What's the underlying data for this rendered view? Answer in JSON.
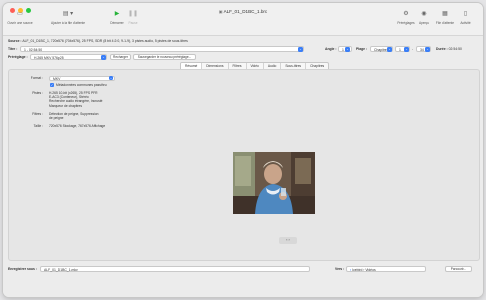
{
  "window": {
    "title": "ALF_01_D1BC_1.brc"
  },
  "toolbar": {
    "left": [
      {
        "label": "Ouvrir une source",
        "icon": "film-icon"
      },
      {
        "label": "Ajouter à la file d'attente",
        "icon": "queue-add-icon"
      },
      {
        "label": "Démarrer",
        "icon": "play-icon"
      },
      {
        "label": "Pause",
        "icon": "pause-icon"
      }
    ],
    "right": [
      {
        "label": "Préréglages",
        "icon": "presets-icon"
      },
      {
        "label": "Aperçu",
        "icon": "eye-icon"
      },
      {
        "label": "File d'attente",
        "icon": "queue-icon"
      },
      {
        "label": "Activité",
        "icon": "activity-icon"
      }
    ]
  },
  "source": {
    "label": "Source :",
    "value": "ALF_01_D1BC_1, 720x576 (704x576), 25 FPS, SDR (8 bit 4:2:0, 9-1-9), 3 pistes audio, 5 pistes de sous-titres"
  },
  "title_row": {
    "label": "Titre :",
    "value": "1 - 02:54:50",
    "angle_label": "Angle :",
    "angle_value": "1",
    "range_label": "Plage :",
    "range_mode": "Chapitres",
    "range_start": "1",
    "range_to": "-",
    "range_end": "34",
    "duration_label": "Durée :",
    "duration_value": "02:54:50"
  },
  "preset_row": {
    "label": "Préréglage :",
    "value": "H.265 MKV 576p25",
    "reload_label": "Recharger",
    "save_label": "Sauvegarder le nouveau préréglage..."
  },
  "tabs": [
    {
      "label": "Résumé",
      "active": true
    },
    {
      "label": "Dimensions",
      "active": false
    },
    {
      "label": "Filtres",
      "active": false
    },
    {
      "label": "Vidéo",
      "active": false
    },
    {
      "label": "Audio",
      "active": false
    },
    {
      "label": "Sous-titres",
      "active": false
    },
    {
      "label": "Chapitres",
      "active": false
    }
  ],
  "summary": {
    "format_label": "Format :",
    "format_value": "MKV",
    "passthru_label": "Métadonnées communes passthru",
    "tracks_label": "Pistes :",
    "tracks_value": "H.265 10-bit (x265), 25 FPS PFR\nE-AC3 (Conteneur), Stéréo\nRecherche audio étrangère, Incrusté\nMarqueur de chapitres",
    "filters_label": "Filtres :",
    "filters_value": "Détection de peigne, Suppression\nde peigne",
    "size_label": "Taille :",
    "size_value": "720x576 Stockage, 767x576 Affichage"
  },
  "preview": {
    "pager": "‹  ›"
  },
  "bottom": {
    "save_label": "Enregistrer sous :",
    "save_value": "ALF_01_D1BC_1.mkv",
    "to_label": "Vers :",
    "to_value": "Icebird › Vidéos",
    "browse_label": "Parcourir..."
  },
  "colors": {
    "accent": "#3a7ef7",
    "start": "#27b33a"
  }
}
